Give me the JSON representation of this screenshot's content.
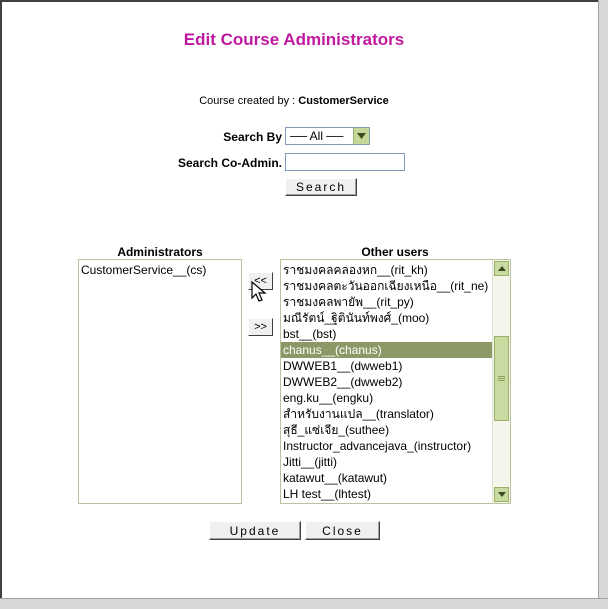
{
  "page": {
    "title": "Edit Course Administrators",
    "created_by_label": "Course created by : ",
    "created_by_value": "CustomerService"
  },
  "search": {
    "search_by_label": "Search By",
    "search_by_value": "── All ──",
    "coadmin_label": "Search Co-Admin.",
    "coadmin_value": "",
    "search_button": "Search"
  },
  "admins": {
    "heading": "Administrators",
    "items": [
      "CustomerService__(cs)"
    ]
  },
  "move": {
    "to_admins": "<<",
    "to_others": ">>"
  },
  "others": {
    "heading": "Other users",
    "selected_index": 5,
    "items": [
      "ราชมงคลคลองหก__(rit_kh)",
      "ราชมงคลตะวันออกเฉียงเหนือ__(rit_ne)",
      "ราชมงคลพายัพ__(rit_py)",
      "มณีรัตน์_ฐิตินันท์พงศ์_(moo)",
      "bst__(bst)",
      "chanus__(chanus)",
      "DWWEB1__(dwweb1)",
      "DWWEB2__(dwweb2)",
      "eng.ku__(engku)",
      "สำหรับงานแปล__(translator)",
      "สุธี_แซ่เจีย_(suthee)",
      "Instructor_advancejava_(instructor)",
      "Jitti__(jitti)",
      "katawut__(katawut)",
      "LH test__(lhtest)"
    ]
  },
  "footer": {
    "update_button": "Update",
    "close_button": "Close"
  },
  "colors": {
    "title": "#c0189f",
    "selection": "#8c9966",
    "scrollbar": "#c8dba0"
  }
}
